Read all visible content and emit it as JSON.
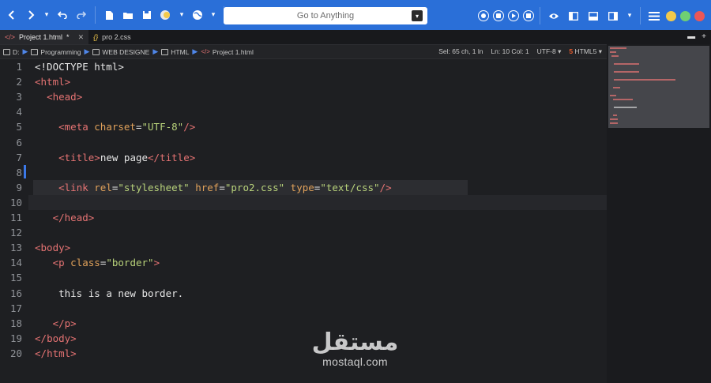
{
  "toolbar": {
    "search_placeholder": "Go to Anything",
    "accent_color": "#2a6fd8"
  },
  "tabs": [
    {
      "label": "Project 1.html",
      "modified": "*",
      "icon": "html-code-icon"
    },
    {
      "label": "pro 2.css",
      "icon": "css-js-icon"
    }
  ],
  "breadcrumb": {
    "items": [
      "D:",
      "Programming",
      "WEB DESIGNE",
      "HTML",
      "Project 1.html"
    ]
  },
  "status": {
    "selection": "Sel: 65 ch, 1 ln",
    "position": "Ln: 10 Col: 1",
    "encoding": "UTF-8",
    "language": "HTML5"
  },
  "editor": {
    "lines": [
      {
        "n": "1",
        "code": "<!DOCTYPE html>"
      },
      {
        "n": "2",
        "code": "<html>"
      },
      {
        "n": "3",
        "code": "  <head>"
      },
      {
        "n": "4",
        "code": ""
      },
      {
        "n": "5",
        "code": "    <meta charset=\"UTF-8\"/>"
      },
      {
        "n": "6",
        "code": ""
      },
      {
        "n": "7",
        "code": "    <title>new page</title>"
      },
      {
        "n": "8",
        "code": ""
      },
      {
        "n": "9",
        "code": "    <link rel=\"stylesheet\" href=\"pro2.css\" type=\"text/css\"/>"
      },
      {
        "n": "10",
        "code": ""
      },
      {
        "n": "11",
        "code": "   </head>"
      },
      {
        "n": "12",
        "code": ""
      },
      {
        "n": "13",
        "code": "<body>"
      },
      {
        "n": "14",
        "code": "   <p class=\"border\">"
      },
      {
        "n": "15",
        "code": ""
      },
      {
        "n": "16",
        "code": "    this is a new border."
      },
      {
        "n": "17",
        "code": ""
      },
      {
        "n": "18",
        "code": "   </p>"
      },
      {
        "n": "19",
        "code": "</body>"
      },
      {
        "n": "20",
        "code": "</html>"
      }
    ]
  },
  "watermark": {
    "arabic": "مستقل",
    "latin": "mostaql.com"
  }
}
